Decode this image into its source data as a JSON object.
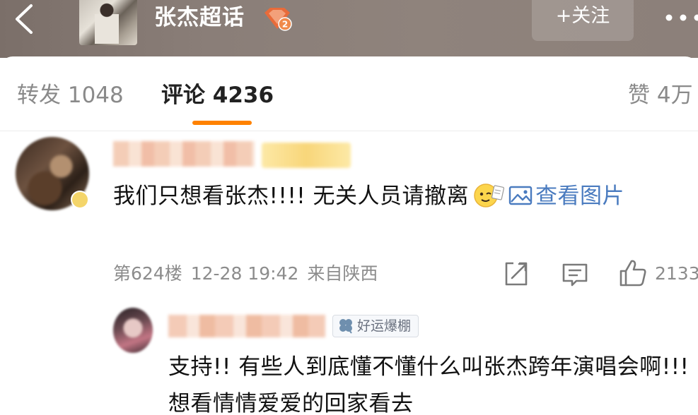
{
  "header": {
    "group_title": "张杰超话",
    "level_badge": "2",
    "follow_label": "+关注"
  },
  "tabs": {
    "repost": "转发 1048",
    "comments": "评论 4236",
    "likes": "赞 4万"
  },
  "comment": {
    "text": "我们只想看张杰!!!! 无关人员请撤离",
    "view_image": "查看图片",
    "floor": "第624楼",
    "time": "12-28 19:42",
    "location": "来自陕西",
    "like_count": "2133"
  },
  "reply": {
    "badge": "好运爆棚",
    "text": "支持!! 有些人到底懂不懂什么叫张杰跨年演唱会啊!!! 想看情情爱爱的回家看去"
  },
  "colors": {
    "accent": "#ff8200",
    "link": "#4a7bbf",
    "meta_gray": "#8c8c8c"
  },
  "icons": [
    "back-icon",
    "level-badge-icon",
    "more-icon",
    "image-icon",
    "share-icon",
    "comment-icon",
    "like-icon",
    "clover-icon",
    "emoji-icon"
  ]
}
